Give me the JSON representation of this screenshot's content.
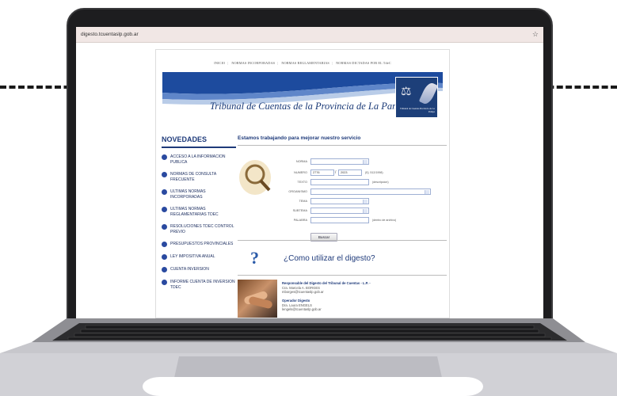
{
  "browser": {
    "url": "digesto.tcuentaslp.gob.ar",
    "star_icon": "star-icon"
  },
  "nav": {
    "items": [
      "INICIO",
      "NORMAS INCORPORADAS",
      "NORMAS REGLAMENTARIAS",
      "NORMAS DICTADAS POR EL TdeC"
    ]
  },
  "banner": {
    "title": "Tribunal de Cuentas de la Provincia de La Pampa",
    "emblem_text": "Tribunal de Cuentas Provincia de La Pampa"
  },
  "novedades": {
    "heading": "NOVEDADES",
    "items": [
      "ACCESO A LA INFORMACION PUBLICA",
      "NORMAS DE CONSULTA FRECUENTE",
      "ULTIMAS NORMAS INCORPORADAS",
      "ULTIMAS NORMAS REGLAMENTARIAS TdeC",
      "RESOLUCIONES TdeC CONTROL PREVIO",
      "PRESUPUESTOS PROVINCIALES",
      "LEY IMPOSITIVA ANUAL",
      "CUENTA INVERSION",
      "INFORME CUENTA DE INVERSION TdeC"
    ]
  },
  "main": {
    "heading": "Estamos trabajando para mejorar nuestro servicio",
    "form": {
      "norma_label": "NORMA",
      "numero_label": "NUMERO",
      "numero_value": "2776",
      "anio_value": "2023",
      "numero_hint": "(Ej. 512/1998)",
      "texto_label": "TEXTO",
      "texto_hint": "(descripcion)",
      "organismo_label": "ORGANISMO",
      "tema_label": "TEMA",
      "subtema_label": "SUBTEMA",
      "palabra_label": "PALABRA",
      "palabra_hint": "(dentro de archivo)",
      "buscar_label": "Buscar"
    },
    "howto": "¿Como utilizar el digesto?",
    "responsable": {
      "title": "Responsable del Digesto del Tribunal de Cuentas - L.P. -",
      "name": "Cra. Marcela A. BORGES",
      "email": "mborges@tcuentaslp.gob.ar",
      "op_title": "Operador Digesto",
      "op_name": "Dra. Laura ENGELS",
      "op_email": "lengels@tcuentaslp.gob.ar"
    }
  }
}
